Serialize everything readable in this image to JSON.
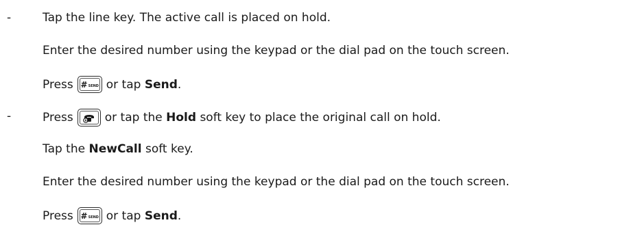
{
  "bullets": {
    "first": {
      "marker": "-",
      "steps": [
        "Tap the line key. The active call is placed on hold.",
        "Enter the desired number using the keypad or the dial pad on the touch screen."
      ],
      "press_prefix": "Press",
      "send_key": {
        "symbol": "#",
        "sub": "SEND",
        "icon": "hash-send-key-icon"
      },
      "press_suffix": "or tap",
      "press_target": "Send",
      "press_end": "."
    },
    "second": {
      "marker": "-",
      "hold_prefix": "Press",
      "hold_key": {
        "icon": "hold-key-icon"
      },
      "hold_mid": "or tap the",
      "hold_target": "Hold",
      "hold_suffix": "soft key to place the original call on hold.",
      "newcall_prefix": "Tap the",
      "newcall_target": "NewCall",
      "newcall_suffix": "soft key.",
      "enter_step": "Enter the desired number using the keypad or the dial pad on the touch screen.",
      "press_prefix": "Press",
      "send_key": {
        "symbol": "#",
        "sub": "SEND",
        "icon": "hash-send-key-icon"
      },
      "press_suffix": "or tap",
      "press_target": "Send",
      "press_end": "."
    }
  }
}
